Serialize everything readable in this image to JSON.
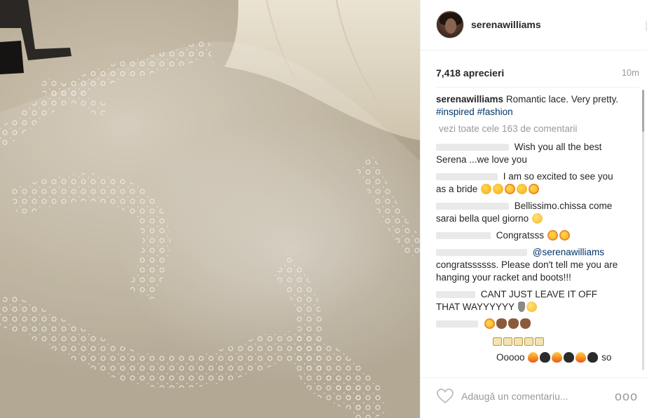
{
  "post": {
    "username": "serenawilliams",
    "likes": "7,418 aprecieri",
    "time": "10m",
    "caption_user": "serenawilliams",
    "caption_text": "Romantic lace. Very pretty.",
    "caption_tags": [
      "#inspired",
      "#fashion"
    ],
    "view_all": "vezi toate cele 163 de comentarii"
  },
  "comments": [
    {
      "text1": "Wish you all the best",
      "text2": "Serena ...we love you"
    },
    {
      "text1": "I am so excited to see you",
      "text2": "as a bride"
    },
    {
      "text1": "Bellissimo.chissa come",
      "text2": "sarai bella quel giorno"
    },
    {
      "text1": "Congratsss"
    },
    {
      "mention": "@serenawilliams",
      "text2": "congratssssss. Please don't tell me you are hanging your racket and boots!!!"
    },
    {
      "text1": "CANT JUST LEAVE IT OFF",
      "text2": "THAT WAYYYYYY"
    },
    {
      "text1": ""
    },
    {
      "text1": ""
    },
    {
      "text1": "Ooooo",
      "text2": "so"
    }
  ],
  "footer": {
    "add_comment_placeholder": "Adaugă un comentariu...",
    "more_label": "ooo"
  },
  "icons": {
    "avatar": "profile-avatar",
    "like": "heart-outline-icon",
    "more": "more-options-icon"
  },
  "colors": {
    "tag": "#003569",
    "muted": "#999999",
    "text": "#262626",
    "border": "#efefef"
  }
}
